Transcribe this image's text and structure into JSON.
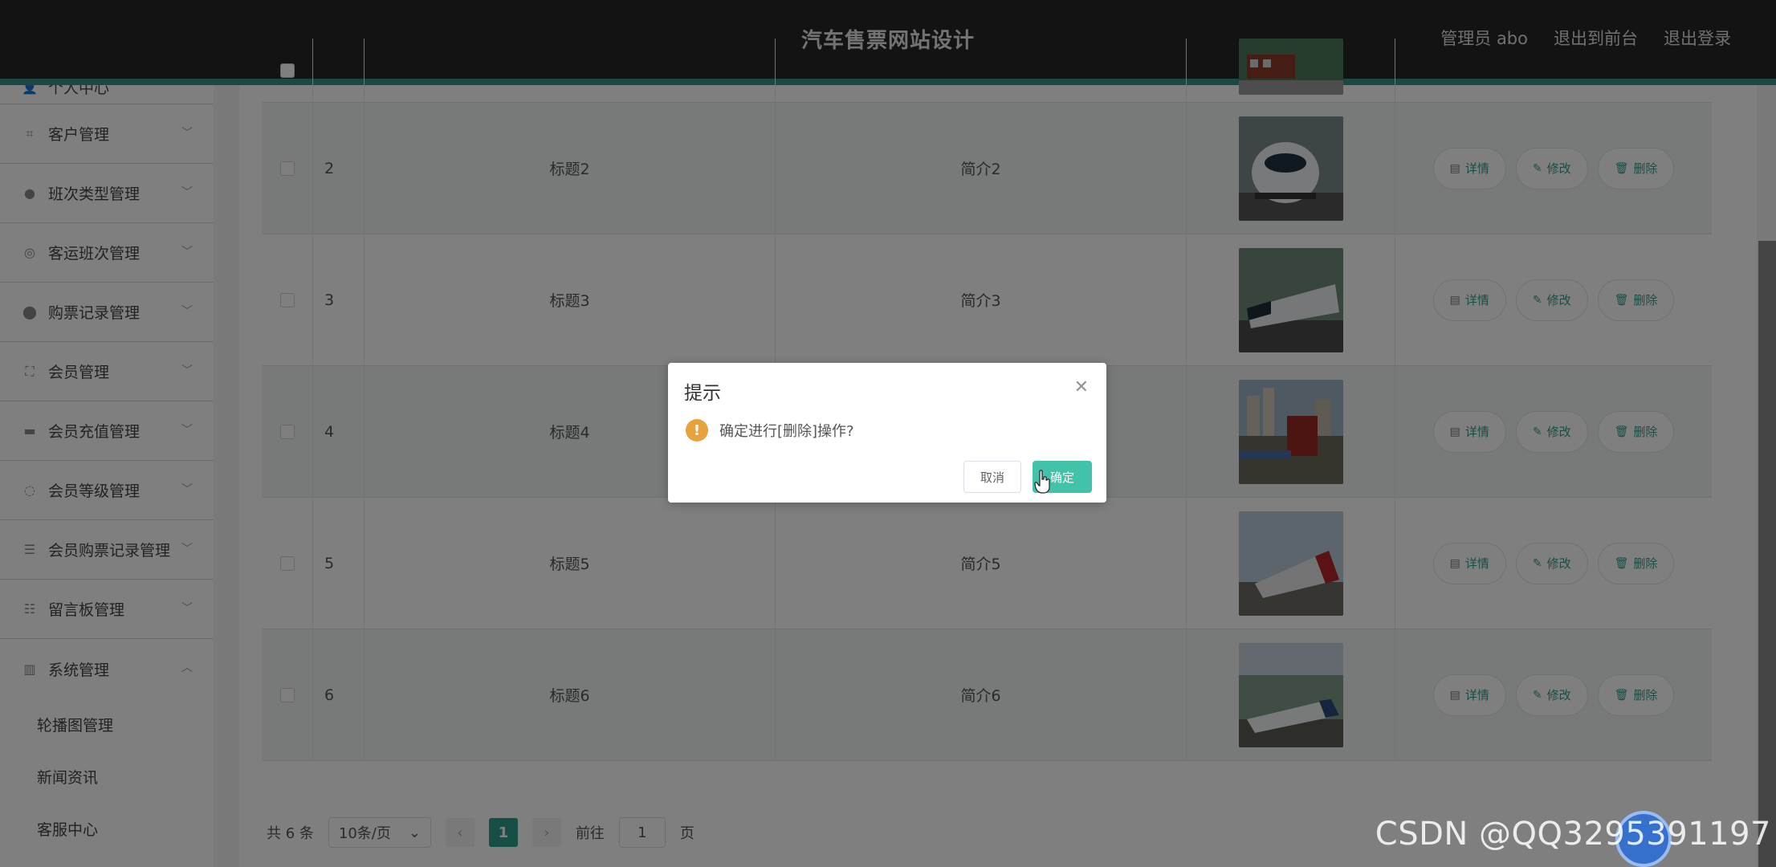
{
  "header": {
    "title": "汽车售票网站设计",
    "links": [
      "管理员 abo",
      "退出到前台",
      "退出登录"
    ]
  },
  "sidebar": {
    "items": [
      {
        "label": "个人中心",
        "icon": "user-icon"
      },
      {
        "label": "客户管理",
        "icon": "crop-icon"
      },
      {
        "label": "班次类型管理",
        "icon": "user-icon"
      },
      {
        "label": "客运班次管理",
        "icon": "compass-icon"
      },
      {
        "label": "购票记录管理",
        "icon": "location-icon"
      },
      {
        "label": "会员管理",
        "icon": "fullscreen-icon"
      },
      {
        "label": "会员充值管理",
        "icon": "ticket-icon"
      },
      {
        "label": "会员等级管理",
        "icon": "alarm-icon"
      },
      {
        "label": "会员购票记录管理",
        "icon": "list-icon"
      },
      {
        "label": "留言板管理",
        "icon": "sliders-icon"
      },
      {
        "label": "系统管理",
        "icon": "bars-icon"
      }
    ],
    "sub_items": [
      "轮播图管理",
      "新闻资讯",
      "客服中心"
    ]
  },
  "table": {
    "rows": [
      {
        "index": "2",
        "title": "标题2",
        "intro": "简介2"
      },
      {
        "index": "3",
        "title": "标题3",
        "intro": "简介3"
      },
      {
        "index": "4",
        "title": "标题4",
        "intro": "简介4"
      },
      {
        "index": "5",
        "title": "标题5",
        "intro": "简介5"
      },
      {
        "index": "6",
        "title": "标题6",
        "intro": "简介6"
      }
    ],
    "actions": {
      "detail": "详情",
      "edit": "修改",
      "delete": "删除"
    }
  },
  "pagination": {
    "total": "共 6 条",
    "page_size": "10条/页",
    "current_page": "1",
    "goto_label": "前往",
    "goto_value": "1",
    "page_suffix": "页"
  },
  "dialog": {
    "title": "提示",
    "message": "确定进行[删除]操作?",
    "cancel": "取消",
    "confirm": "确定"
  },
  "watermark": "CSDN @QQ3295391197",
  "colors": {
    "accent": "#2f9c8c",
    "confirm": "#42c2a8",
    "warning": "#e6a23c",
    "header": "#262626"
  }
}
